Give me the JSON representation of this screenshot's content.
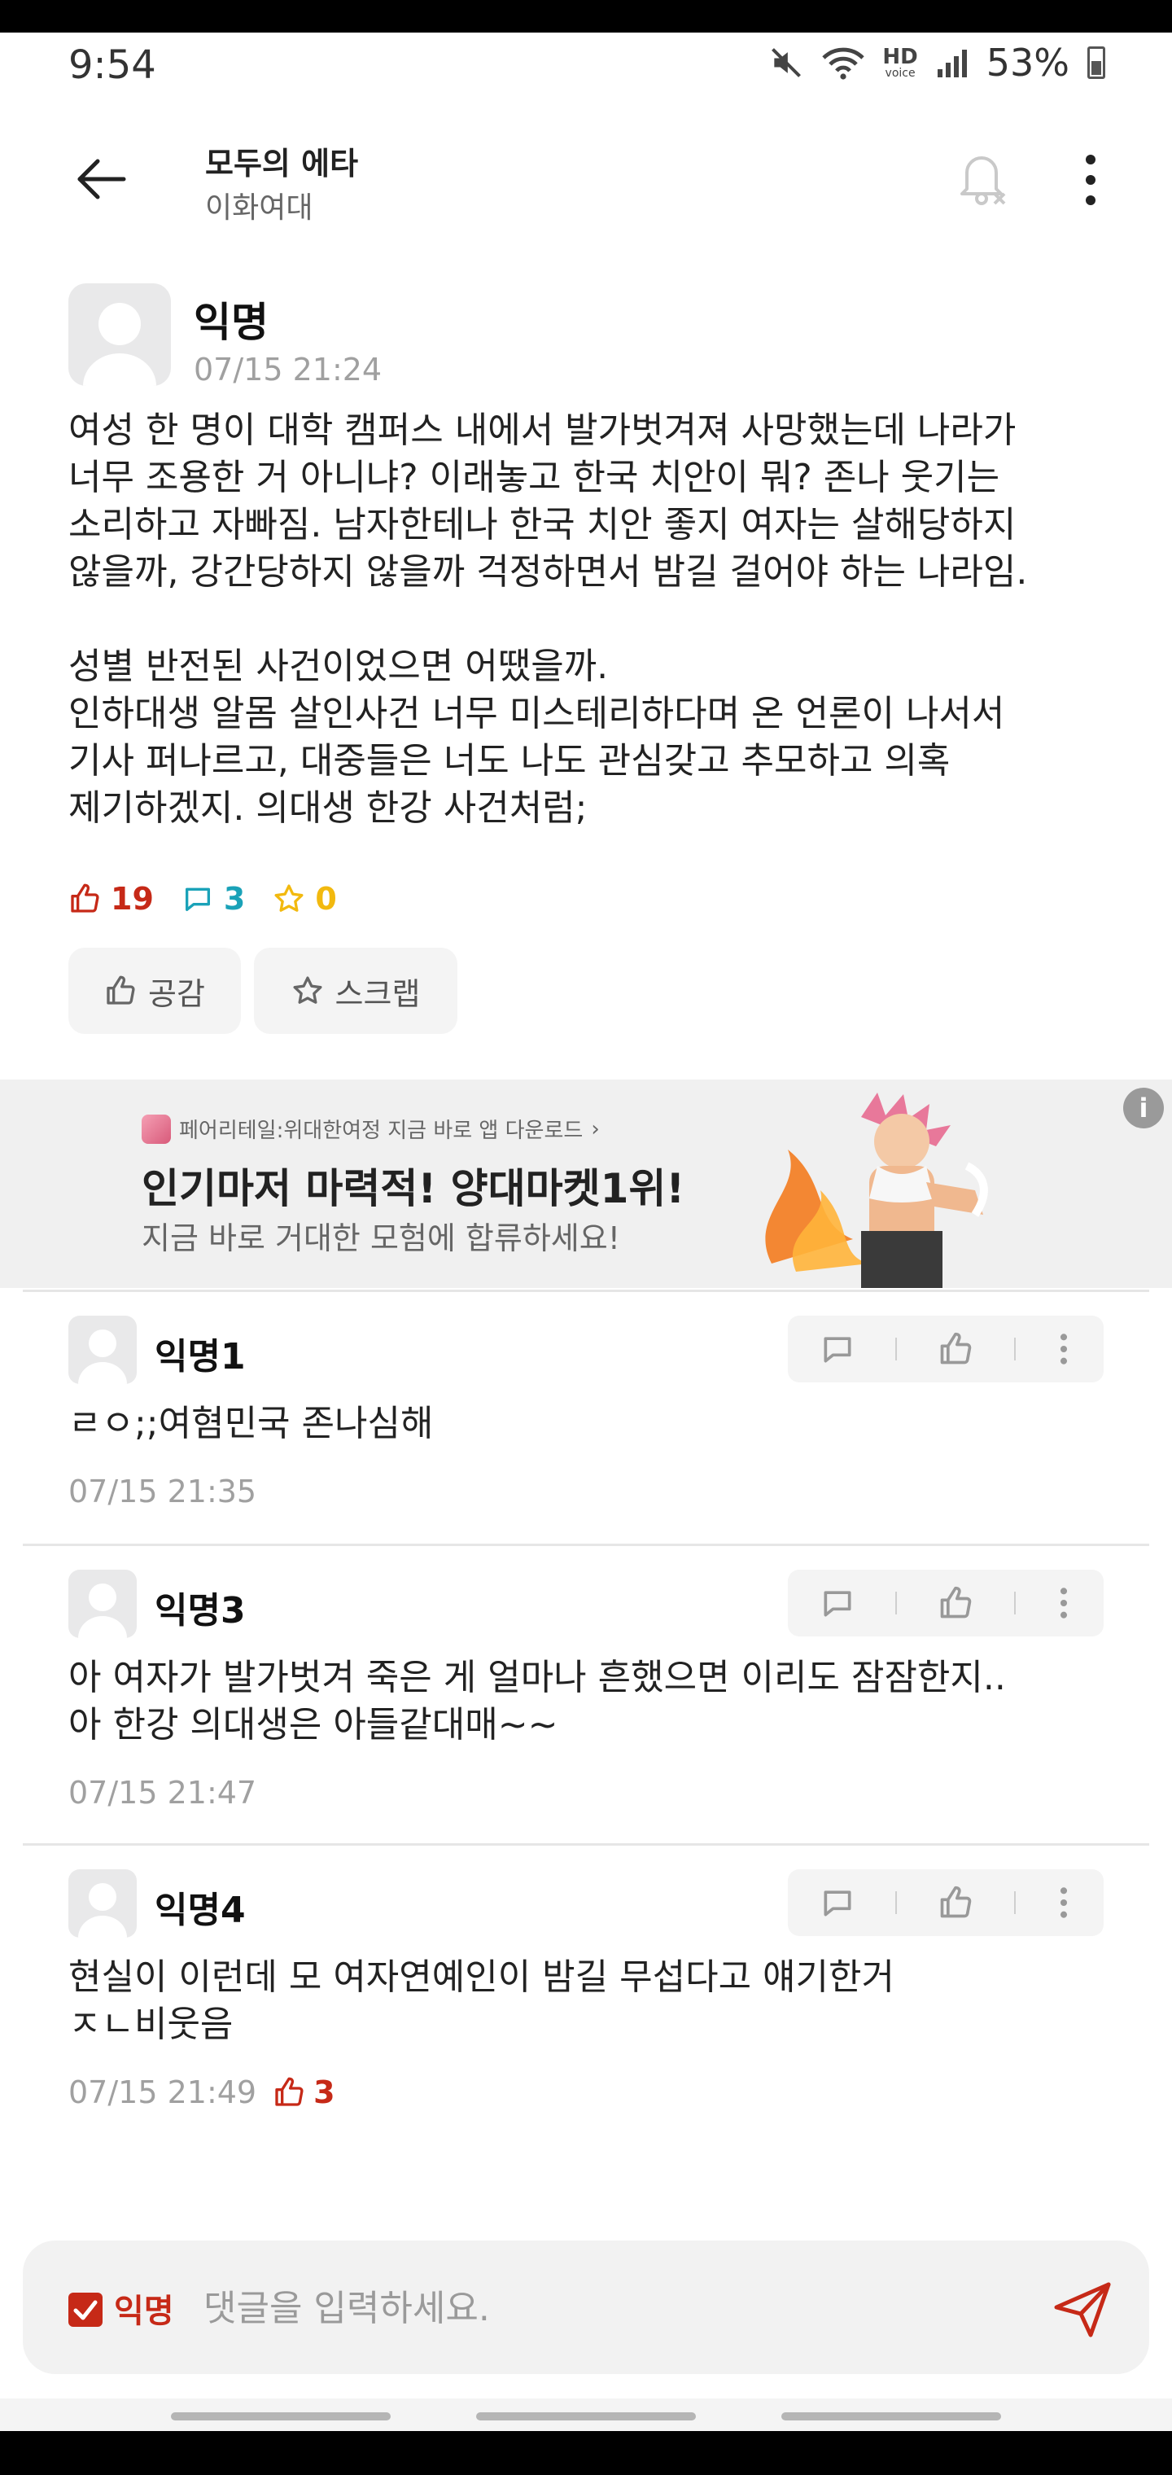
{
  "status_bar": {
    "time": "9:54",
    "hd_label": "HD",
    "voice_label": "voice",
    "battery": "53%"
  },
  "header": {
    "title": "모두의 에타",
    "subtitle": "이화여대"
  },
  "post": {
    "author": "익명",
    "time": "07/15 21:24",
    "body": "여성 한 명이 대학 캠퍼스 내에서 발가벗겨져 사망했는데 나라가\n너무 조용한 거 아니냐? 이래놓고 한국 치안이 뭐? 존나 웃기는\n소리하고 자빠짐. 남자한테나 한국 치안 좋지 여자는 살해당하지\n않을까, 강간당하지 않을까 걱정하면서 밤길 걸어야 하는 나라임.\n\n성별 반전된 사건이었으면 어땠을까.\n인하대생 알몸 살인사건 너무 미스테리하다며 온 언론이 나서서\n기사 퍼나르고, 대중들은 너도 나도 관심갖고 추모하고 의혹\n제기하겠지. 의대생 한강 사건처럼;",
    "likes": "19",
    "comments": "3",
    "scraps": "0",
    "like_button": "공감",
    "scrap_button": "스크랩"
  },
  "ad": {
    "sponsor": "페어리테일:위대한여정 지금 바로 앱 다운로드",
    "sponsor_arrow": "›",
    "title": "인기마저 마력적! 양대마켓1위!",
    "description": "지금 바로 거대한 모험에 합류하세요!",
    "info": "i"
  },
  "comments": [
    {
      "author": "익명1",
      "text": "ㄹㅇ;;여혐민국 존나심해",
      "time": "07/15 21:35",
      "likes": ""
    },
    {
      "author": "익명3",
      "text": "아 여자가 발가벗겨 죽은 게 얼마나 흔했으면 이리도 잠잠한지..\n아 한강 의대생은 아들같대매~~",
      "time": "07/15 21:47",
      "likes": ""
    },
    {
      "author": "익명4",
      "text": "현실이 이런데 모 여자연예인이 밤길 무섭다고 얘기한거\nㅈㄴ비웃음",
      "time": "07/15 21:49",
      "likes": "3"
    }
  ],
  "comment_input": {
    "anon_label": "익명",
    "placeholder": "댓글을 입력하세요."
  },
  "colors": {
    "accent_red": "#c62917",
    "comment_teal": "#1aa2b8",
    "scrap_yellow": "#f2b90f"
  }
}
